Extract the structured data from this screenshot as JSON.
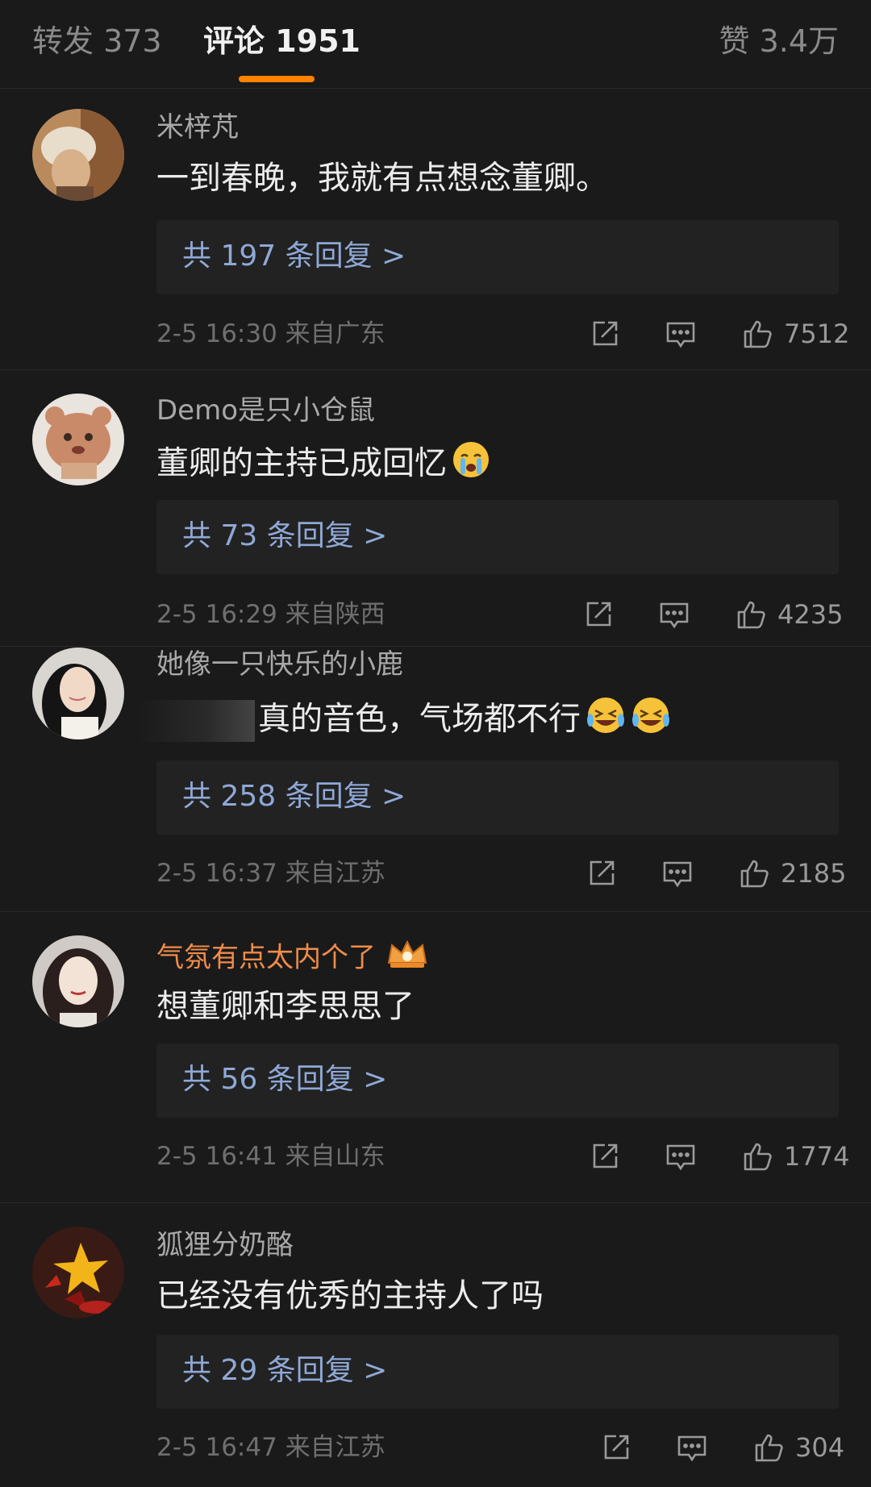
{
  "tabs": {
    "repost": "转发 373",
    "comments": "评论 1951",
    "likes": "赞 3.4万"
  },
  "comments": [
    {
      "username": "米梓芃",
      "text": "一到春晚，我就有点想念董卿。",
      "replies": "共 197 条回复 >",
      "meta": "2-5 16:30  来自广东",
      "likes": "7512"
    },
    {
      "username": "Demo是只小仓鼠",
      "text": "董卿的主持已成回忆",
      "emoji": "crying-emoji",
      "replies": "共 73 条回复 >",
      "meta": "2-5 16:29  来自陕西",
      "likes": "4235"
    },
    {
      "username": "她像一只快乐的小鹿",
      "text": "真的音色，气场都不行",
      "emoji": "laugh-cry-emoji",
      "replies": "共 258 条回复 >",
      "meta": "2-5 16:37  来自江苏",
      "likes": "2185"
    },
    {
      "username": "气氛有点太内个了",
      "badge": "vip-crown-icon",
      "text": "想董卿和李思思了",
      "replies": "共 56 条回复 >",
      "meta": "2-5 16:41  来自山东",
      "likes": "1774"
    },
    {
      "username": "狐狸分奶酪",
      "text": "已经没有优秀的主持人了吗",
      "replies": "共 29 条回复 >",
      "meta": "2-5 16:47  来自江苏",
      "likes": "304"
    }
  ],
  "colors": {
    "background": "#1a1a1a",
    "accent": "#ff8200",
    "link": "#8fa8d6",
    "vip_name": "#f08c4a"
  }
}
